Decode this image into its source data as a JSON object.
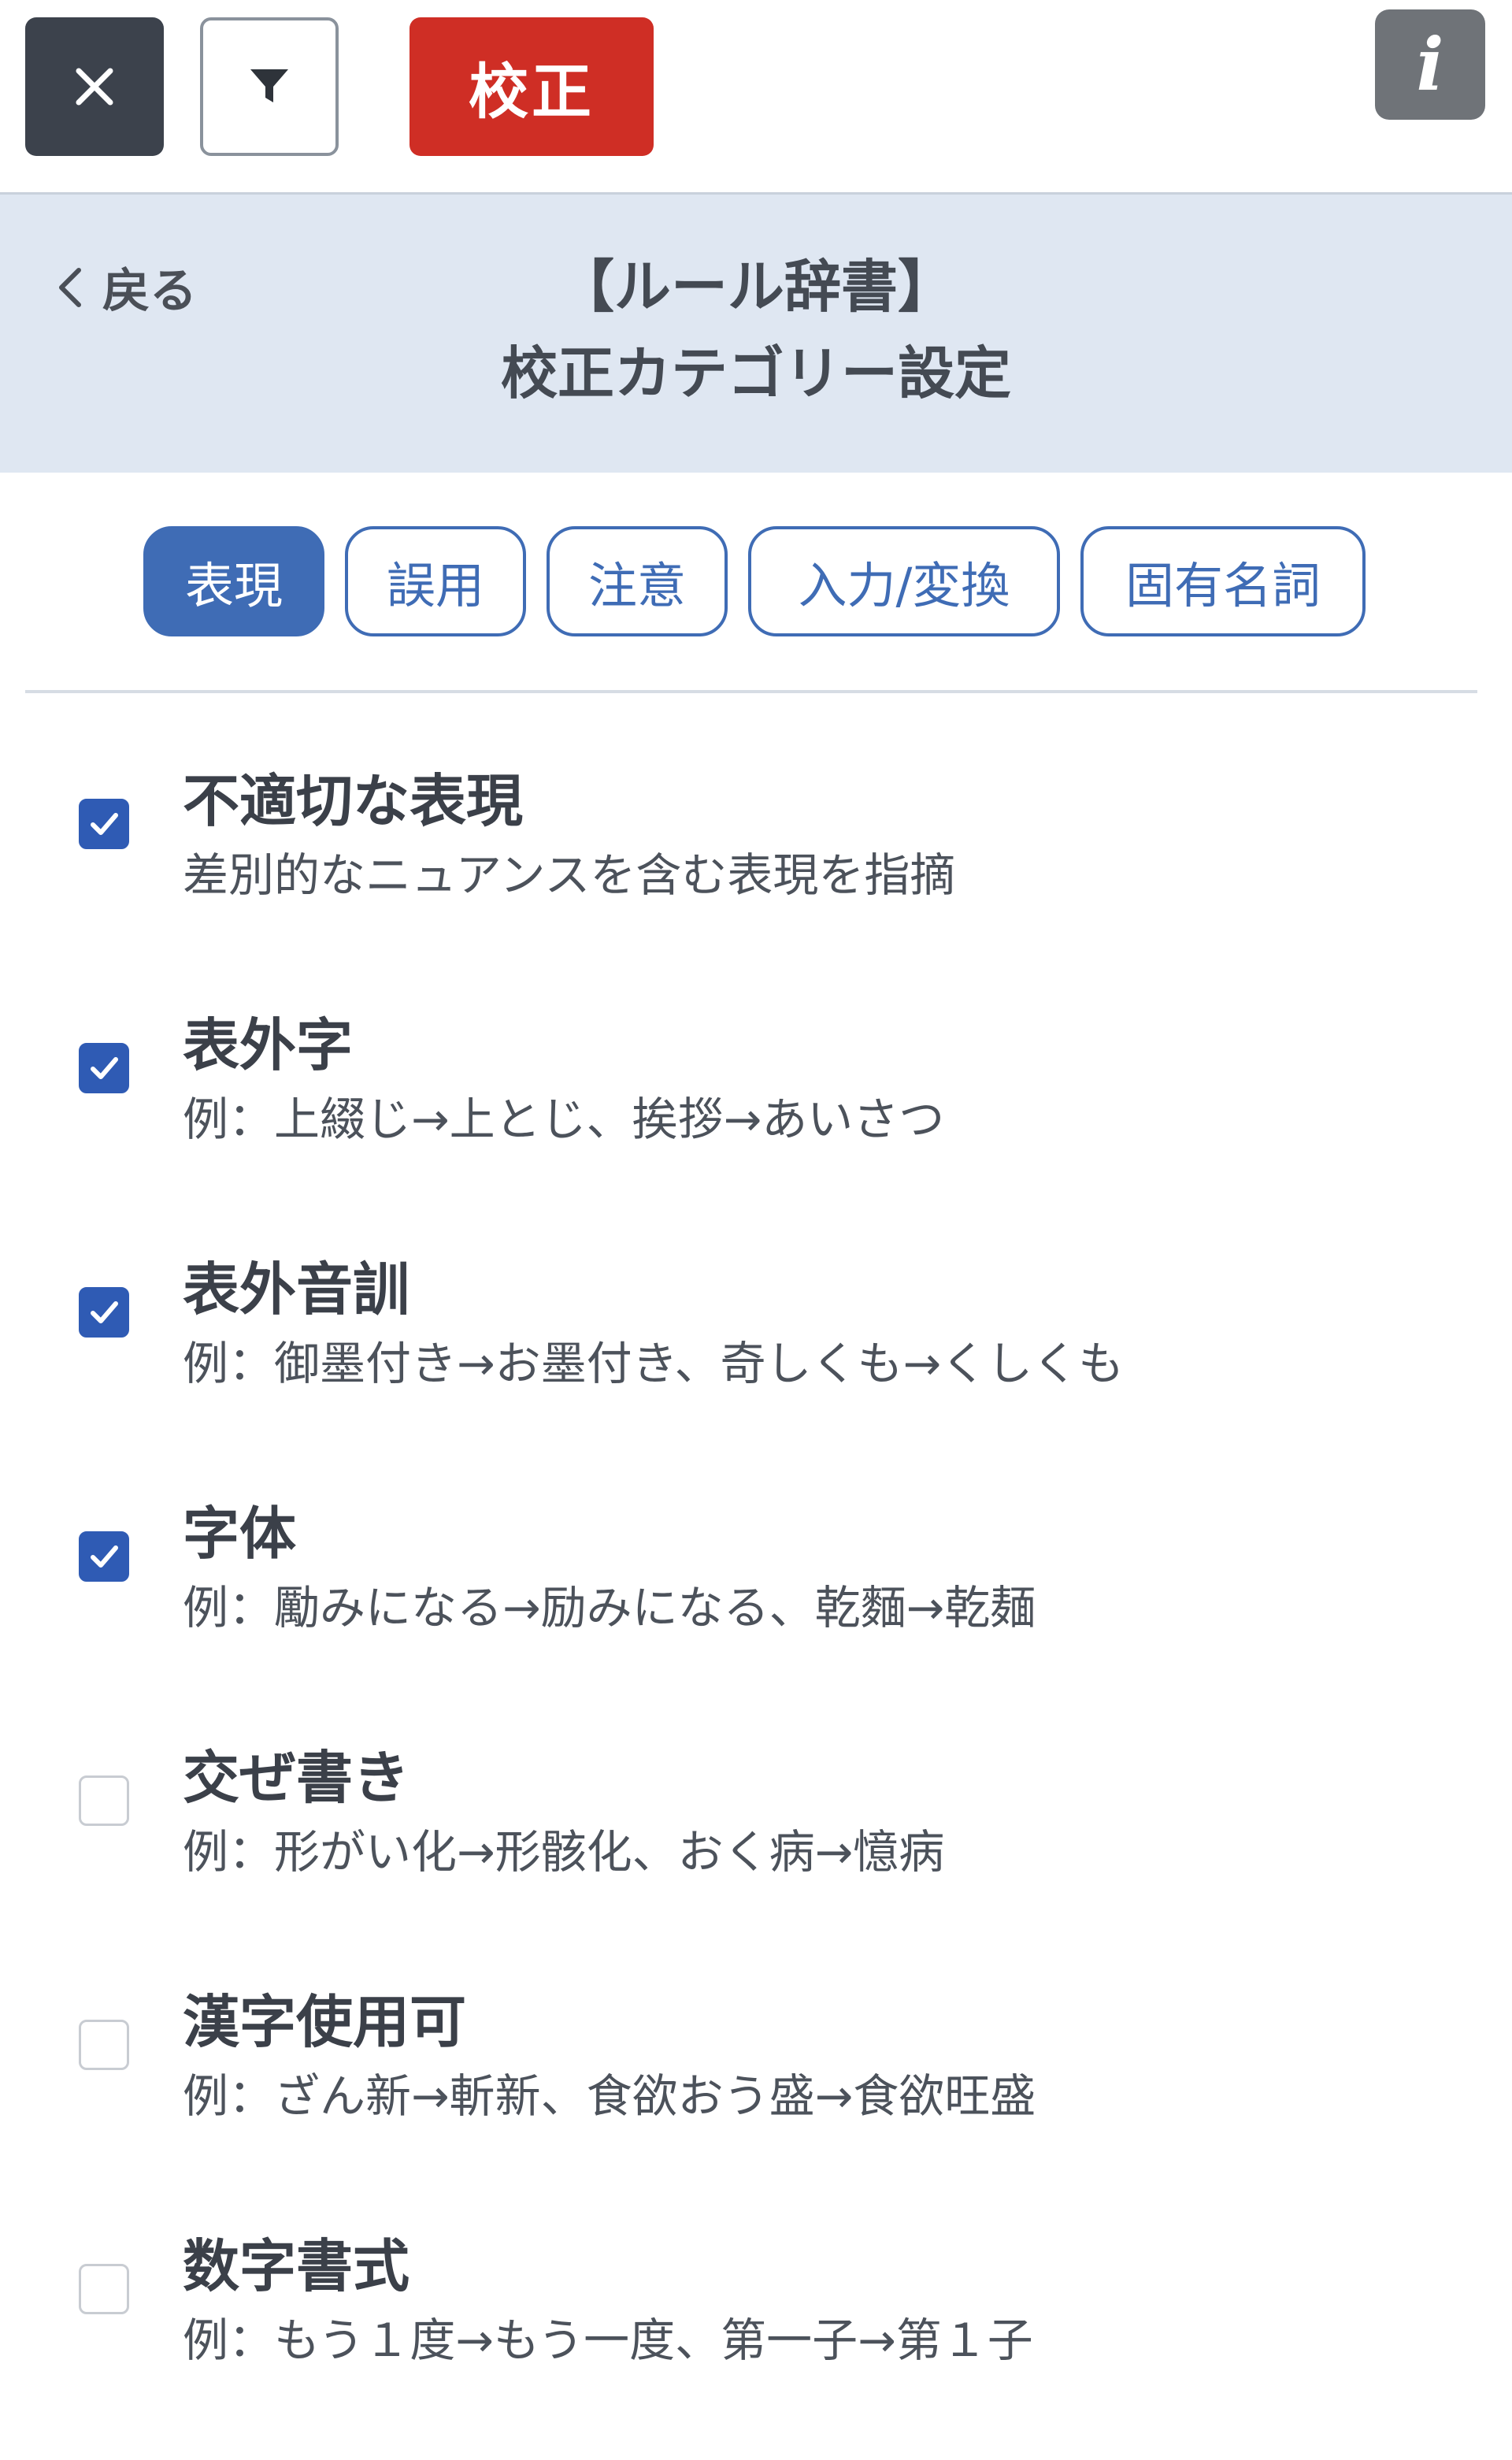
{
  "toolbar": {
    "close_icon": "close-x-icon",
    "filter_icon": "funnel-filter-icon",
    "proof_label": "校正",
    "info_icon": "info-i-icon",
    "info_glyph": "i"
  },
  "header": {
    "back_label": "戻る",
    "title_line1": "【ルール辞書】",
    "title_line2": "校正カテゴリー設定"
  },
  "tabs": [
    {
      "label": "表現",
      "active": true
    },
    {
      "label": "誤用",
      "active": false
    },
    {
      "label": "注意",
      "active": false
    },
    {
      "label": "入力/変換",
      "active": false
    },
    {
      "label": "固有名詞",
      "active": false
    }
  ],
  "items": [
    {
      "title": "不適切な表現",
      "desc": "差別的なニュアンスを含む表現を指摘",
      "checked": true
    },
    {
      "title": "表外字",
      "desc": "例：上綴じ→上とじ、挨拶→あいさつ",
      "checked": true
    },
    {
      "title": "表外音訓",
      "desc": "例：御墨付き→お墨付き、奇しくも→くしくも",
      "checked": true
    },
    {
      "title": "字体",
      "desc": "例：勵みになる→励みになる、乾麵→乾麺",
      "checked": true
    },
    {
      "title": "交ぜ書き",
      "desc": "例：形がい化→形骸化、おく病→憶病",
      "checked": false
    },
    {
      "title": "漢字使用可",
      "desc": "例：ざん新→斬新、食欲おう盛→食欲旺盛",
      "checked": false
    },
    {
      "title": "数字書式",
      "desc": "例：もう１度→もう一度、第一子→第１子",
      "checked": false
    }
  ],
  "colors": {
    "primary": "#3f6cb5",
    "checked": "#2f5bb4",
    "proof_button": "#cf2e25",
    "header_bg": "#dfe7f2"
  }
}
